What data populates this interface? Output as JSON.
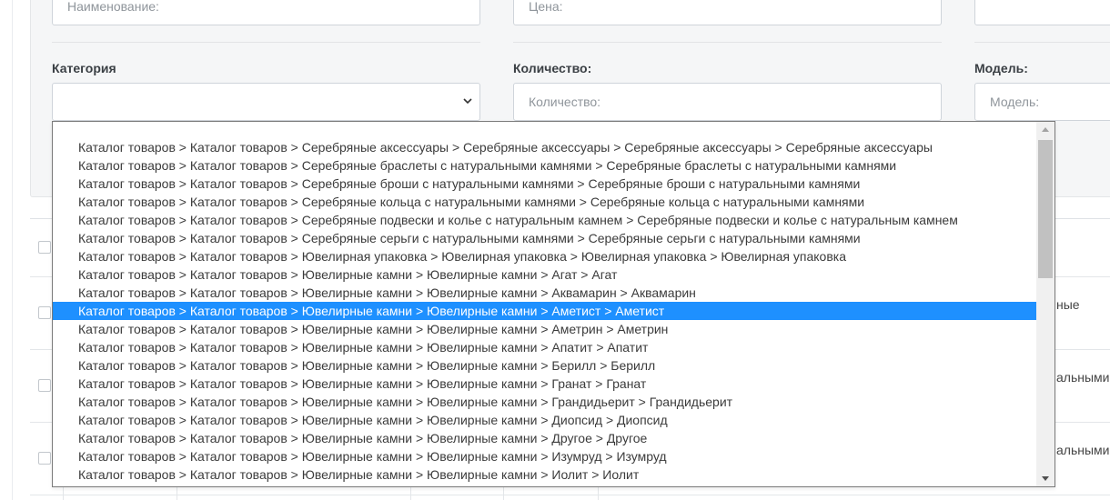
{
  "filters": {
    "name_placeholder": "Наименование:",
    "price_placeholder": "Цена:",
    "category_label": "Категория",
    "category_value": "",
    "quantity_label": "Количество:",
    "quantity_placeholder": "Количество:",
    "model_label": "Модель:",
    "model_placeholder": "Модель:"
  },
  "table_peek": [
    "ные",
    "альными",
    "альными"
  ],
  "category_options": [
    "Каталог товаров  >  Каталог товаров  >  Серебряные аксессуары  >  Серебряные аксессуары  >  Серебряные аксессуары  >  Серебряные аксессуары",
    "Каталог товаров  >  Каталог товаров  >  Серебряные браслеты с натуральными камнями  >  Серебряные браслеты с натуральными камнями",
    "Каталог товаров  >  Каталог товаров  >  Серебряные броши с натуральными камнями  >  Серебряные броши с натуральными камнями",
    "Каталог товаров  >  Каталог товаров  >  Серебряные кольца с натуральными камнями  >  Серебряные кольца с натуральными камнями",
    "Каталог товаров  >  Каталог товаров  >  Серебряные подвески и колье с натуральным камнем  >  Серебряные подвески и колье с натуральным камнем",
    "Каталог товаров  >  Каталог товаров  >  Серебряные серьги с натуральными камнями  >  Серебряные серьги с натуральными камнями",
    "Каталог товаров  >  Каталог товаров  >  Ювелирная упаковка  >  Ювелирная упаковка  >  Ювелирная упаковка  >  Ювелирная упаковка",
    "Каталог товаров  >  Каталог товаров  >  Ювелирные камни  >  Ювелирные камни  >  Агат  >  Агат",
    "Каталог товаров  >  Каталог товаров  >  Ювелирные камни  >  Ювелирные камни  >  Аквамарин  >  Аквамарин",
    "Каталог товаров  >  Каталог товаров  >  Ювелирные камни  >  Ювелирные камни  >  Аметист  >  Аметист",
    "Каталог товаров  >  Каталог товаров  >  Ювелирные камни  >  Ювелирные камни  >  Аметрин  >  Аметрин",
    "Каталог товаров  >  Каталог товаров  >  Ювелирные камни  >  Ювелирные камни  >  Апатит  >  Апатит",
    "Каталог товаров  >  Каталог товаров  >  Ювелирные камни  >  Ювелирные камни  >  Берилл  >  Берилл",
    "Каталог товаров  >  Каталог товаров  >  Ювелирные камни  >  Ювелирные камни  >  Гранат  >  Гранат",
    "Каталог товаров  >  Каталог товаров  >  Ювелирные камни  >  Ювелирные камни  >  Грандидьерит  >  Грандидьерит",
    "Каталог товаров  >  Каталог товаров  >  Ювелирные камни  >  Ювелирные камни  >  Диопсид  >  Диопсид",
    "Каталог товаров  >  Каталог товаров  >  Ювелирные камни  >  Ювелирные камни  >  Другое  >  Другое",
    "Каталог товаров  >  Каталог товаров  >  Ювелирные камни  >  Ювелирные камни  >  Изумруд  >  Изумруд",
    "Каталог товаров  >  Каталог товаров  >  Ювелирные камни  >  Ювелирные камни  >  Иолит  >  Иолит"
  ],
  "selected_option_index": 9,
  "colors": {
    "highlight": "#1e90ff",
    "panel_bg": "#f5f6f7"
  },
  "icons": {
    "select_caret": "chevron-down-icon",
    "scroll_up": "triangle-up-icon",
    "scroll_down": "triangle-down-icon"
  }
}
